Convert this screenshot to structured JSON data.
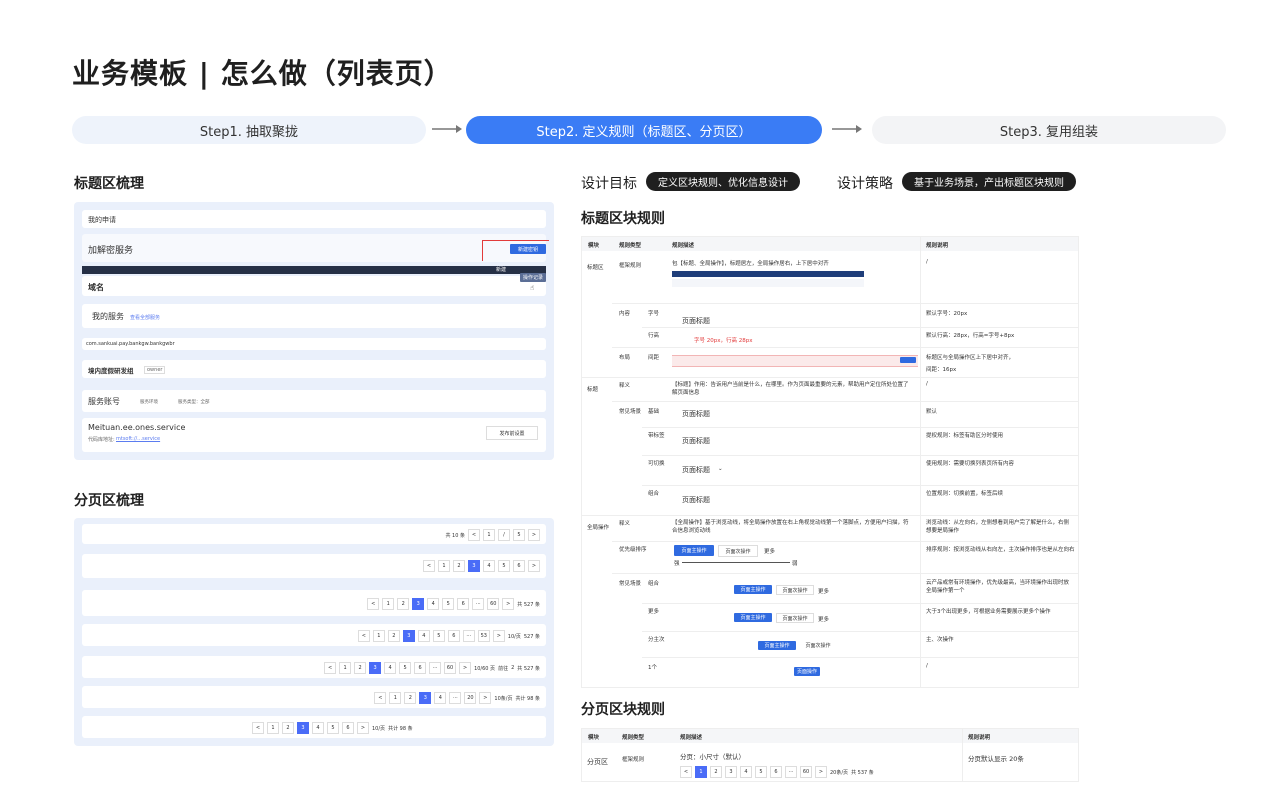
{
  "title": "业务模板 | 怎么做（列表页）",
  "steps": [
    "Step1. 抽取聚拢",
    "Step2. 定义规则（标题区、分页区）",
    "Step3. 复用组装"
  ],
  "left": {
    "title_section": "标题区梳理",
    "paging_section": "分页区梳理",
    "title_rows": {
      "r1": "我的申请",
      "r2": "加解密服务",
      "r2_btn": "新建密钥",
      "r3_small": "新建",
      "r3_btn": "操作记录",
      "r4": "域名",
      "r5": "我的服务",
      "r5_link": "查看全部服务",
      "r6": "com.sankuai.pay.bankgw.bankgwbr",
      "r7": "境内度假研发组",
      "r7_tag": "owner",
      "r8": "服务账号",
      "r8_a": "服务环境",
      "r8_b": "服务类型：全部",
      "r9_title": "Meituan.ee.ones.service",
      "r9_sub": "代码库地址:",
      "r9_link": "mtsoft://…service",
      "r9_btn": "发布前设置"
    },
    "paging_rows": [
      {
        "total": "共 10 条",
        "pages": [
          "<",
          "1",
          "/",
          "5",
          ">"
        ]
      },
      {
        "pages": [
          "<",
          "1",
          "2",
          "3",
          "4",
          "5",
          "6",
          ">"
        ],
        "active": "3"
      },
      {
        "pages": [
          "<",
          "1",
          "2",
          "3",
          "4",
          "5",
          "6",
          "···",
          "60",
          ">"
        ],
        "active": "3",
        "extra": "共 527 条"
      },
      {
        "pages": [
          "<",
          "1",
          "2",
          "3",
          "4",
          "5",
          "6",
          "···",
          "53",
          ">"
        ],
        "active": "3",
        "extra1": "10/页",
        "extra2": "527 条"
      },
      {
        "pages": [
          "<",
          "1",
          "2",
          "3",
          "4",
          "5",
          "6",
          "···",
          "60",
          ">"
        ],
        "active": "3",
        "extra1": "10/60 页",
        "extra2": "前往",
        "extra3": "2",
        "extra4": "共 527 条"
      },
      {
        "pages": [
          "<",
          "1",
          "2",
          "3",
          "4",
          "···",
          "20",
          ">"
        ],
        "active": "3",
        "extra1": "10条/页",
        "extra2": "共计 98 条"
      },
      {
        "pages": [
          "<",
          "1",
          "2",
          "3",
          "4",
          "5",
          "6",
          ">"
        ],
        "active": "3",
        "extra1": "10/页",
        "extra2": "共计 98 条"
      }
    ]
  },
  "right": {
    "goal_label": "设计目标",
    "goal_pill": "定义区块规则、优化信息设计",
    "strategy_label": "设计策略",
    "strategy_pill": "基于业务场景，产出标题区块规则",
    "title_rules": "标题区块规则",
    "paging_rules": "分页区块规则",
    "table_headers": [
      "模块",
      "规则类型",
      "规则描述",
      "规则说明"
    ],
    "t1": {
      "mod_title_area": "标题区",
      "frame_rule": "框架规则",
      "frame_desc": "包【标题、全局操作】，标题居左，全局操作居右，上下居中对齐",
      "frame_note": "/",
      "content": "内容",
      "font_size": "字号",
      "line_height": "行高",
      "page_title": "页面标题",
      "font_size_note": "默认字号：20px",
      "red_note": "字号 20px，行高 28px",
      "line_height_note": "默认行高：28px，行高=字号+8px",
      "layout": "布局",
      "spacing": "间距",
      "layout_note": "标题区与全局操作区上下居中对齐，",
      "spacing_note": "间距：16px",
      "mod_title": "标题",
      "meaning": "释义",
      "title_meaning": "【标题】作用：告诉用户当前是什么，在哪里。作为页面最重要的元素，帮助用户定位所处位置了解页面信息",
      "title_meaning_note": "/",
      "common_scene": "常见场景",
      "basic": "基础",
      "basic_note": "默认",
      "with_tag": "带标签",
      "with_tag_note": "提权规则：标签有助区分时使用",
      "switchable": "可切换",
      "switch_note": "使用规则：需要切换列表页所有内容",
      "combo": "组合",
      "combo_note": "位置规则：切换前置，标签后续",
      "mod_global": "全局操作",
      "global_meaning": "【全局操作】基于浏览动线，将全局操作放置在右上角视觉动线第一个落脚点，方便用户扫描，符合信息浏览动线",
      "global_meaning_note": "浏览动线：从左向右，左侧想看到用户完了解是什么，右侧想要是局操作",
      "priority": "优先级排序",
      "primary_op": "页面主操作",
      "secondary_op": "页面次操作",
      "more": "更多",
      "strong": "强",
      "weak": "弱",
      "priority_note": "排序规则：按浏览动线从右向左，主次操作排序也是从左向右",
      "combo2_note": "云产品或常有环境操作，优先级最高，当环境操作出现时放全局操作第一个",
      "more2": "更多",
      "more_note": "大于3个出现更多，可根据业务需要展示更多个操作",
      "primary_secondary": "分主次",
      "ps_note": "主、次操作",
      "one": "1个",
      "one_note": "/",
      "page_op": "页面操作"
    },
    "t2": {
      "mod": "分页区",
      "frame_rule": "框架规则",
      "desc": "分页：小尺寸（默认）",
      "note": "分页默认显示 20条",
      "pages": [
        "<",
        "1",
        "2",
        "3",
        "4",
        "5",
        "6",
        "···",
        "60",
        ">"
      ],
      "per_page": "20条/页",
      "total": "共 537 条"
    }
  }
}
